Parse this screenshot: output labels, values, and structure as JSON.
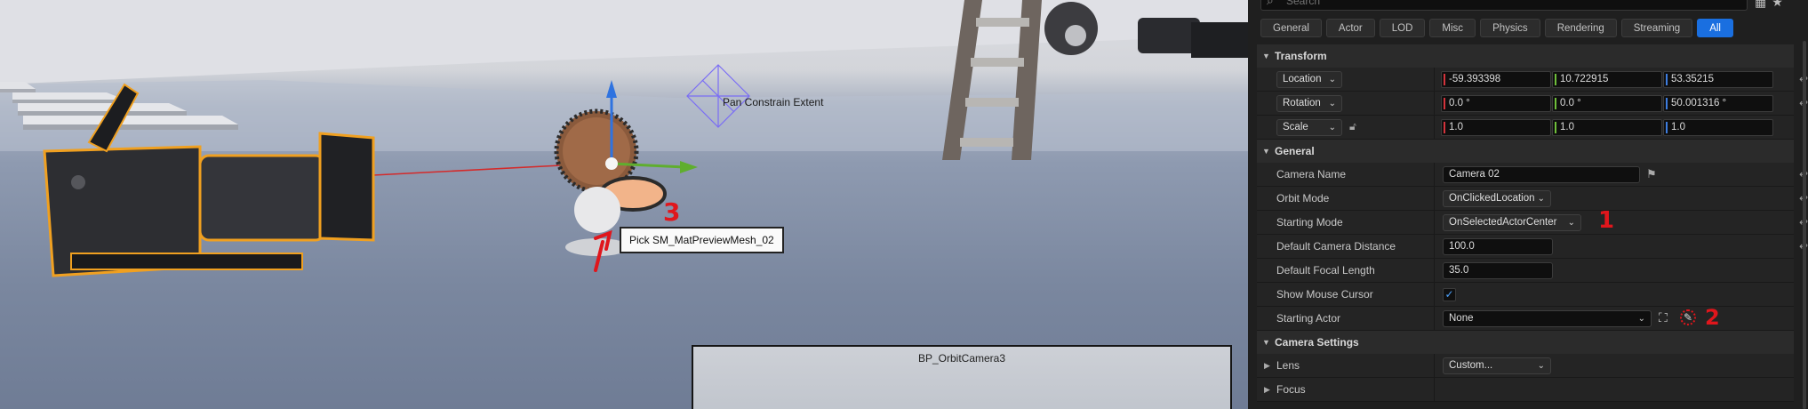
{
  "viewport": {
    "gizmo_label": "Pan Constrain Extent",
    "tooltip": "Pick SM_MatPreviewMesh_02",
    "preview_title": "BP_OrbitCamera3",
    "annotation_1": "1",
    "annotation_3": "3"
  },
  "search": {
    "placeholder": "Search"
  },
  "tabs": [
    "General",
    "Actor",
    "LOD",
    "Misc",
    "Physics",
    "Rendering",
    "Streaming",
    "All"
  ],
  "active_tab": "All",
  "transform": {
    "title": "Transform",
    "location": {
      "label": "Location",
      "x": "-59.393398",
      "y": "10.722915",
      "z": "53.35215"
    },
    "rotation": {
      "label": "Rotation",
      "x": "0.0 °",
      "y": "0.0 °",
      "z": "50.001316 °"
    },
    "scale": {
      "label": "Scale",
      "x": "1.0",
      "y": "1.0",
      "z": "1.0"
    }
  },
  "general": {
    "title": "General",
    "camera_name": {
      "label": "Camera Name",
      "value": "Camera 02"
    },
    "orbit_mode": {
      "label": "Orbit Mode",
      "value": "OnClickedLocation"
    },
    "starting_mode": {
      "label": "Starting Mode",
      "value": "OnSelectedActorCenter"
    },
    "default_camera_distance": {
      "label": "Default Camera Distance",
      "value": "100.0"
    },
    "default_focal_length": {
      "label": "Default Focal Length",
      "value": "35.0"
    },
    "show_mouse_cursor": {
      "label": "Show Mouse Cursor",
      "checked": true
    },
    "starting_actor": {
      "label": "Starting Actor",
      "value": "None"
    }
  },
  "camera_settings": {
    "title": "Camera Settings",
    "lens": {
      "label": "Lens",
      "value": "Custom..."
    },
    "focus": {
      "label": "Focus"
    }
  },
  "annotations": {
    "one": "1",
    "two": "2",
    "three": "3"
  },
  "colors": {
    "accent": "#1a6fe0",
    "axis_x": "#d4333b",
    "axis_y": "#6fbf3a",
    "axis_z": "#3d7de0",
    "annotation": "#e0161c",
    "selection": "#f0a020"
  }
}
